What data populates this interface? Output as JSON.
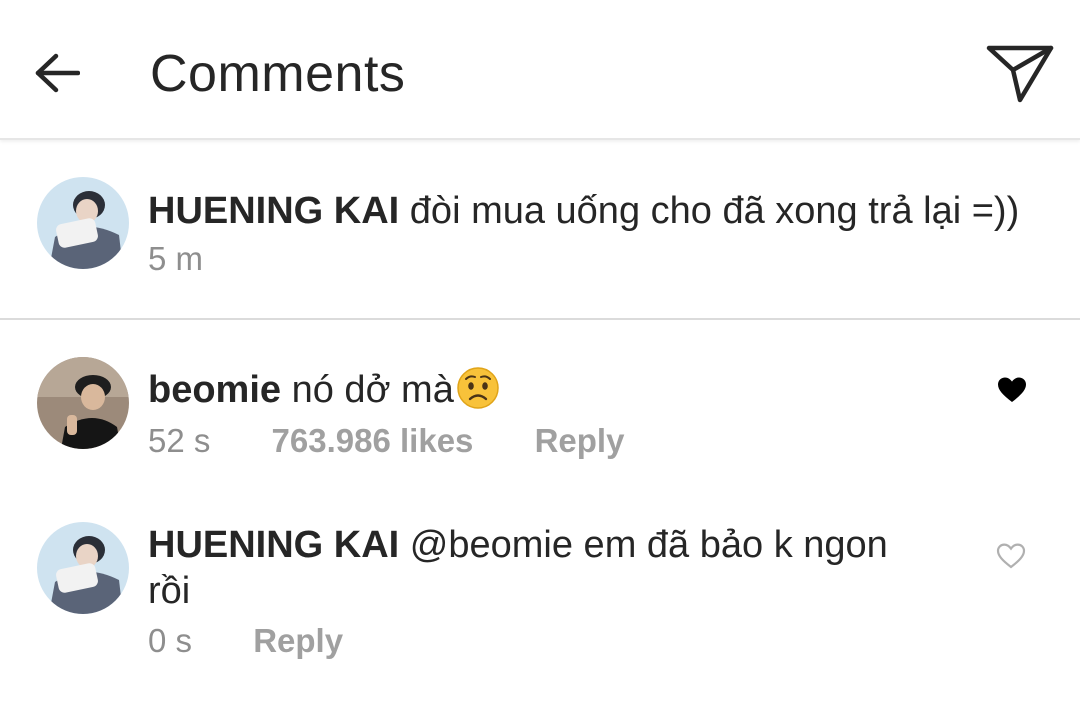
{
  "header": {
    "title": "Comments"
  },
  "caption": {
    "username": "HUENING KAI",
    "text": "đòi mua uống cho đã xong trả lại =))",
    "time": "5 m"
  },
  "comments": [
    {
      "username": "beomie",
      "text": "nó dở mà",
      "emoji": "worried-face",
      "time": "52 s",
      "likes": "763.986 likes",
      "reply_label": "Reply",
      "liked": true
    },
    {
      "username": "HUENING KAI",
      "text_line1": "@beomie em đã bảo k ngon",
      "text_line2": "rồi",
      "time": "0 s",
      "reply_label": "Reply",
      "liked": false
    }
  ],
  "colors": {
    "text": "#262626",
    "secondary": "#8e8e8e",
    "divider": "#dbdbdb",
    "heart_filled": "#000000",
    "heart_outline": "#b0b0b0"
  }
}
